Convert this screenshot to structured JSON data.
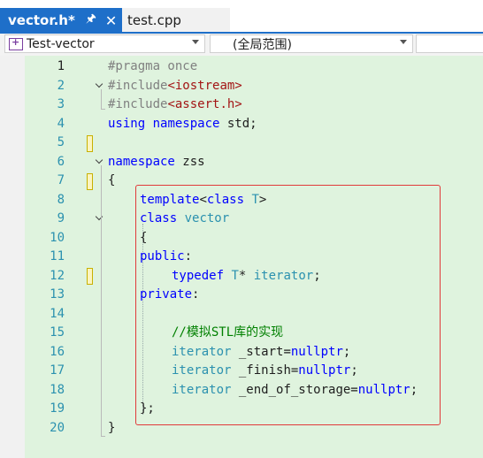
{
  "tabs": {
    "active": {
      "name": "vector.h*",
      "pin_icon": "pin-icon",
      "close_icon": "close-icon"
    },
    "inactive": {
      "name": "test.cpp"
    }
  },
  "nav": {
    "project": "Test-vector",
    "scope": "(全局范围)"
  },
  "code": {
    "lines": [
      {
        "no": "1"
      },
      {
        "no": "2"
      },
      {
        "no": "3"
      },
      {
        "no": "4"
      },
      {
        "no": "5"
      },
      {
        "no": "6"
      },
      {
        "no": "7"
      },
      {
        "no": "8"
      },
      {
        "no": "9"
      },
      {
        "no": "10"
      },
      {
        "no": "11"
      },
      {
        "no": "12"
      },
      {
        "no": "13"
      },
      {
        "no": "14"
      },
      {
        "no": "15"
      },
      {
        "no": "16"
      },
      {
        "no": "17"
      },
      {
        "no": "18"
      },
      {
        "no": "19"
      },
      {
        "no": "20"
      }
    ],
    "t": {
      "l1a": "#pragma once",
      "l2a": "#include",
      "l2b": "<iostream>",
      "l3a": "#include",
      "l3b": "<assert.h>",
      "l4a": "using",
      "l4b": " ",
      "l4c": "namespace",
      "l4d": " std;",
      "l7a": "namespace",
      "l7b": " zss",
      "l8a": "{",
      "l9a": "template",
      "l9b": "<",
      "l9c": "class",
      "l9d": " ",
      "l9e": "T",
      "l9f": ">",
      "l10a": "class",
      "l10b": " ",
      "l10c": "vector",
      "l11a": "{",
      "l12a": "public",
      "l12b": ":",
      "l13a": "typedef",
      "l13b": " ",
      "l13c": "T",
      "l13d": "* ",
      "l13e": "iterator",
      "l13f": ";",
      "l14a": "private",
      "l14b": ":",
      "l16a": "//模拟STL库的实现",
      "l17a": "iterator",
      "l17b": " _start=",
      "l17c": "nullptr",
      "l17d": ";",
      "l18a": "iterator",
      "l18b": " _finish=",
      "l18c": "nullptr",
      "l18d": ";",
      "l19a": "iterator",
      "l19b": " _end_of_storage=",
      "l19c": "nullptr",
      "l19d": ";",
      "l20a": "};",
      "l21a": "}"
    }
  },
  "colors": {
    "tab_active": "#1e6fc9",
    "highlight_box": "#e03a3a",
    "code_background": "#dff3de"
  }
}
